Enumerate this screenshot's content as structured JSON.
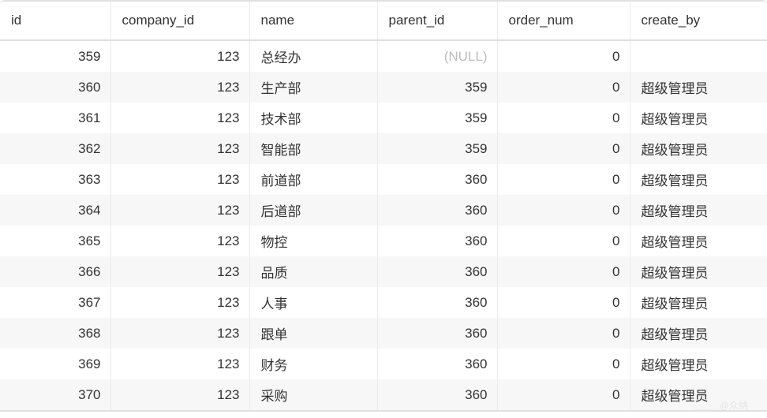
{
  "table": {
    "columns": [
      {
        "key": "id",
        "label": "id",
        "align": "right"
      },
      {
        "key": "company_id",
        "label": "company_id",
        "align": "right"
      },
      {
        "key": "name",
        "label": "name",
        "align": "left"
      },
      {
        "key": "parent_id",
        "label": "parent_id",
        "align": "right"
      },
      {
        "key": "order_num",
        "label": "order_num",
        "align": "right"
      },
      {
        "key": "create_by",
        "label": "create_by",
        "align": "left"
      }
    ],
    "null_display": "(NULL)",
    "rows": [
      {
        "id": "359",
        "company_id": "123",
        "name": "总经办",
        "parent_id": null,
        "order_num": "0",
        "create_by": ""
      },
      {
        "id": "360",
        "company_id": "123",
        "name": "生产部",
        "parent_id": "359",
        "order_num": "0",
        "create_by": "超级管理员"
      },
      {
        "id": "361",
        "company_id": "123",
        "name": "技术部",
        "parent_id": "359",
        "order_num": "0",
        "create_by": "超级管理员"
      },
      {
        "id": "362",
        "company_id": "123",
        "name": "智能部",
        "parent_id": "359",
        "order_num": "0",
        "create_by": "超级管理员"
      },
      {
        "id": "363",
        "company_id": "123",
        "name": "前道部",
        "parent_id": "360",
        "order_num": "0",
        "create_by": "超级管理员"
      },
      {
        "id": "364",
        "company_id": "123",
        "name": "后道部",
        "parent_id": "360",
        "order_num": "0",
        "create_by": "超级管理员"
      },
      {
        "id": "365",
        "company_id": "123",
        "name": "物控",
        "parent_id": "360",
        "order_num": "0",
        "create_by": "超级管理员"
      },
      {
        "id": "366",
        "company_id": "123",
        "name": "品质",
        "parent_id": "360",
        "order_num": "0",
        "create_by": "超级管理员"
      },
      {
        "id": "367",
        "company_id": "123",
        "name": "人事",
        "parent_id": "360",
        "order_num": "0",
        "create_by": "超级管理员"
      },
      {
        "id": "368",
        "company_id": "123",
        "name": "跟单",
        "parent_id": "360",
        "order_num": "0",
        "create_by": "超级管理员"
      },
      {
        "id": "369",
        "company_id": "123",
        "name": "财务",
        "parent_id": "360",
        "order_num": "0",
        "create_by": "超级管理员"
      },
      {
        "id": "370",
        "company_id": "123",
        "name": "采购",
        "parent_id": "360",
        "order_num": "0",
        "create_by": "超级管理员"
      }
    ]
  },
  "watermark": "_____@众纳"
}
